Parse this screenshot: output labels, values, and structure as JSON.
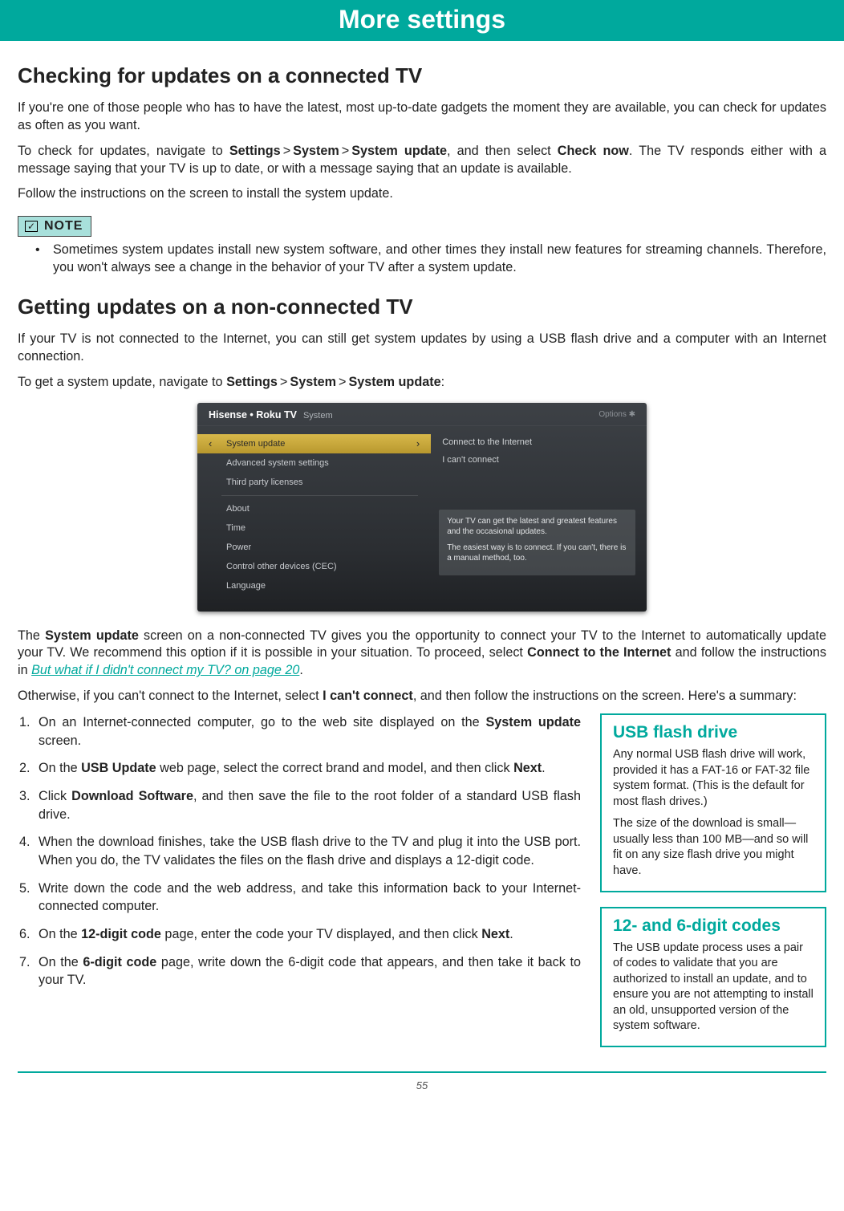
{
  "banner": "More settings",
  "section1": {
    "heading": "Checking for updates on a connected TV",
    "p1": "If you're one of those people who has to have the latest, most up-to-date gadgets the moment they are available, you can check for updates as often as you want.",
    "p2_pre": "To check for updates, navigate to ",
    "nav_settings": "Settings",
    "nav_system": "System",
    "nav_sysupdate": "System update",
    "p2_mid": ", and then select ",
    "nav_check": "Check now",
    "p2_post": ". The TV responds either with a message saying that your TV is up to date, or with a message saying that an update is available.",
    "p3": "Follow the instructions on the screen to install the system update.",
    "note_label": "NOTE",
    "note_bullet": "Sometimes system updates install new system software, and other times they install new features for streaming channels. Therefore, you won't always see a change in the behavior of your TV after a system update."
  },
  "section2": {
    "heading": "Getting updates on a non-connected TV",
    "p1": "If your TV is not connected to the Internet, you can still get system updates by using a USB flash drive and a computer with an Internet connection.",
    "p2_pre": "To get a system update, navigate to ",
    "p2_post": ":"
  },
  "tv": {
    "brand": "Hisense • Roku TV",
    "crumb": "System",
    "options_label": "Options ✱",
    "left": [
      "System update",
      "Advanced system settings",
      "Third party licenses",
      "About",
      "Time",
      "Power",
      "Control other devices (CEC)",
      "Language"
    ],
    "right_opts": [
      "Connect to the Internet",
      "I can't connect"
    ],
    "desc1": "Your TV can get the latest and greatest features and the occasional updates.",
    "desc2": "The easiest way is to connect.  If you can't, there is a manual method, too."
  },
  "section3": {
    "p1a": "The ",
    "p1b": "System update",
    "p1c": " screen on a non-connected TV gives you the opportunity to connect your TV to the Internet to automatically update your TV. We recommend this option if it is possible in your situation. To proceed, select ",
    "p1d": "Connect to the Internet",
    "p1e": " and follow the instructions in ",
    "link": "But what if I didn't connect my TV? on page 20",
    "p1f": ".",
    "p2a": "Otherwise, if you can't connect to the Internet, select ",
    "p2b": "I can't connect",
    "p2c": ", and then follow the instructions on the screen. Here's a summary:",
    "steps": [
      {
        "pre": "On an Internet-connected computer, go to the web site displayed on the ",
        "b": "System update",
        "post": " screen."
      },
      {
        "pre": "On the ",
        "b": "USB Update",
        "post": " web page, select the correct brand and model, and then click ",
        "b2": "Next",
        "post2": "."
      },
      {
        "pre": "Click ",
        "b": "Download Software",
        "post": ", and then save the file to the root folder of a standard USB flash drive."
      },
      {
        "pre": "When the download finishes, take the USB flash drive to the TV and plug it into the USB port. When you do, the TV validates the files on the flash drive and displays a 12-digit code."
      },
      {
        "pre": "Write down the code and the web address, and take this information back to your Internet-connected computer."
      },
      {
        "pre": "On the ",
        "b": "12-digit code",
        "post": " page, enter the code your TV displayed, and then click ",
        "b2": "Next",
        "post2": "."
      },
      {
        "pre": "On the ",
        "b": "6-digit code",
        "post": " page, write down the 6-digit code that appears, and then take it back to your TV."
      }
    ]
  },
  "side_usb": {
    "title": "USB flash drive",
    "p1": "Any normal USB flash drive will work, provided it has a FAT-16 or FAT-32 file system format. (This is the default for most flash drives.)",
    "p2": "The size of the download is small—usually less than 100 MB—and so will fit on any size flash drive you might have."
  },
  "side_codes": {
    "title": "12- and 6-digit codes",
    "p1": "The USB update process uses a pair of codes to validate that you are authorized to install an update, and to ensure you are not attempting to install an old, unsupported version of the system software."
  },
  "page_number": "55"
}
